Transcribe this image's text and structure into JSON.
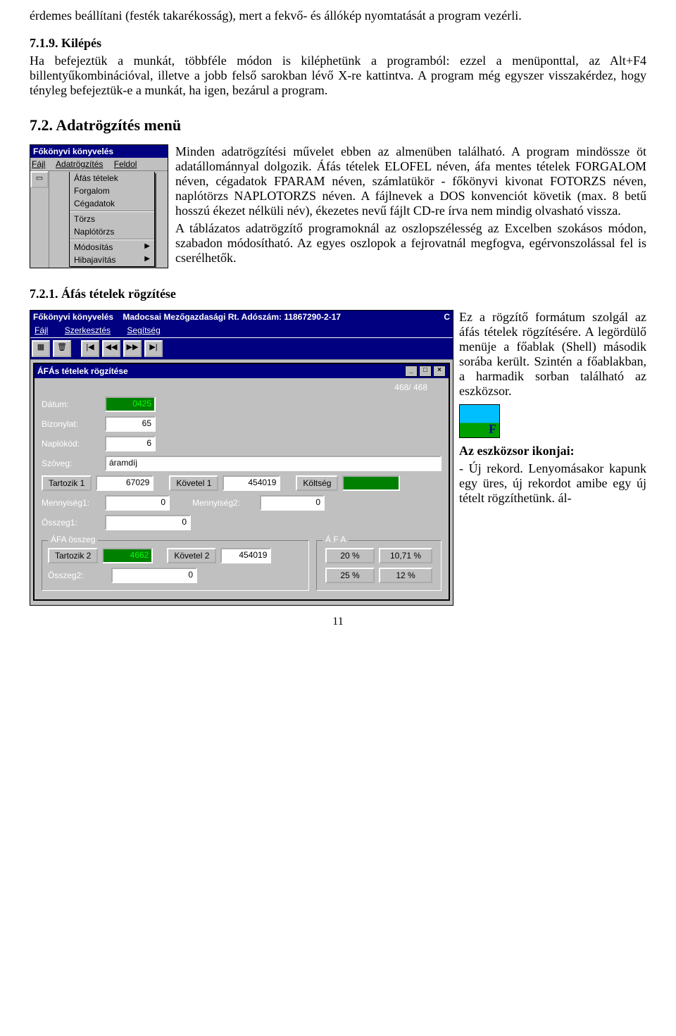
{
  "doc": {
    "intro_para": "érdemes beállítani (festék takarékosság), mert a fekvő- és állókép nyomtatását a program vezérli.",
    "sec_719": {
      "num": "7.1.9. Kilépés",
      "body": "Ha befejeztük a munkát, többféle módon is kiléphetünk a programból: ezzel a menüponttal, az Alt+F4 billentyűkombinációval, illetve a jobb felső sarokban lévő X-re kattintva. A program még egyszer visszakérdez, hogy tényleg befejeztük-e a munkát, ha igen, bezárul a program."
    },
    "sec_72": {
      "heading": "7.2. Adatrögzítés menü",
      "body": "Minden adatrögzítési művelet ebben az almenüben található. A program mindössze öt adatállománnyal dolgozik. Áfás tételek ELOFEL néven, áfa mentes tételek FORGALOM néven, cégadatok FPARAM néven, számlatükör - főkönyvi kivonat FOTORZS néven, naplótörzs NAPLOTORZS néven. A fájlnevek a DOS konvenciót követik (max. 8 betű hosszú ékezet nélküli név), ékezetes nevű fájlt CD-re írva nem mindig olvasható vissza.",
      "body2": "A táblázatos adatrögzítő programoknál az oszlopszélesség az Excelben szokásos módon, szabadon módosítható. Az egyes oszlopok a fejrovatnál megfogva, egérvonszolással fel is cserélhetők."
    },
    "sec_721_title": "7.2.1. Áfás tételek rögzítése",
    "side721": {
      "p1": "Ez a rögzítő formátum szolgál az áfás tételek rögzítésére. A legördülő menüje a főablak (Shell) második sorába került. Szintén a főablakban, a harmadik sorban található az eszközsor.",
      "p2a": "Az eszközsor ikonjai:",
      "p2b": "- Új rekord. Lenyomásakor kapunk egy üres, új rekordot amibe egy új tételt rögzíthetünk. ál-"
    },
    "page_number": "11"
  },
  "menu_capture": {
    "app_title": "Főkönyvi könyvelés",
    "menu": [
      "Fájl",
      "Adatrögzítés",
      "Feldol"
    ],
    "items": [
      "Áfás tételek",
      "Forgalom",
      "Cégadatok",
      "Törzs",
      "Naplótörzs",
      "Módosítás",
      "Hibajavítás"
    ]
  },
  "shell_capture": {
    "title_app": "Főkönyvi könyvelés",
    "title_rest": "Madocsai Mezőgazdasági Rt. Adószám: 11867290-2-17",
    "title_right": "C",
    "menu": [
      "Fájl",
      "Szerkesztés",
      "Segítség"
    ],
    "form_title": "ÁFÁs tételek rögzítése",
    "counter": "468/ 468",
    "labels": {
      "datum": "Dátum:",
      "bizonylat": "Bizonylat:",
      "naplokod": "Naplókód:",
      "szoveg": "Szöveg:",
      "tartozik1": "Tartozik 1",
      "kovetel1": "Követel 1",
      "koltseg": "Költség",
      "menny1": "Mennyiség1:",
      "menny2": "Mennyiség2:",
      "osszeg1": "Összeg1:",
      "afa_group": "ÁFA összeg",
      "afa_right_group": "Á F A",
      "tartozik2": "Tartozik 2",
      "kovetel2": "Követel 2",
      "osszeg2": "Összeg2:"
    },
    "values": {
      "datum": "0425",
      "bizonylat": "65",
      "naplokod": "6",
      "szoveg": "áramdíj",
      "tartozik1": "67029",
      "kovetel1": "454019",
      "koltseg": "",
      "menny1": "0",
      "menny2": "0",
      "osszeg1": "0",
      "tartozik2": "4662",
      "kovetel2": "454019",
      "osszeg2": "0",
      "afa_pct_a": "20 %",
      "afa_pct_b": "10,71 %",
      "afa_pct_c": "25 %",
      "afa_pct_d": "12 %"
    }
  }
}
